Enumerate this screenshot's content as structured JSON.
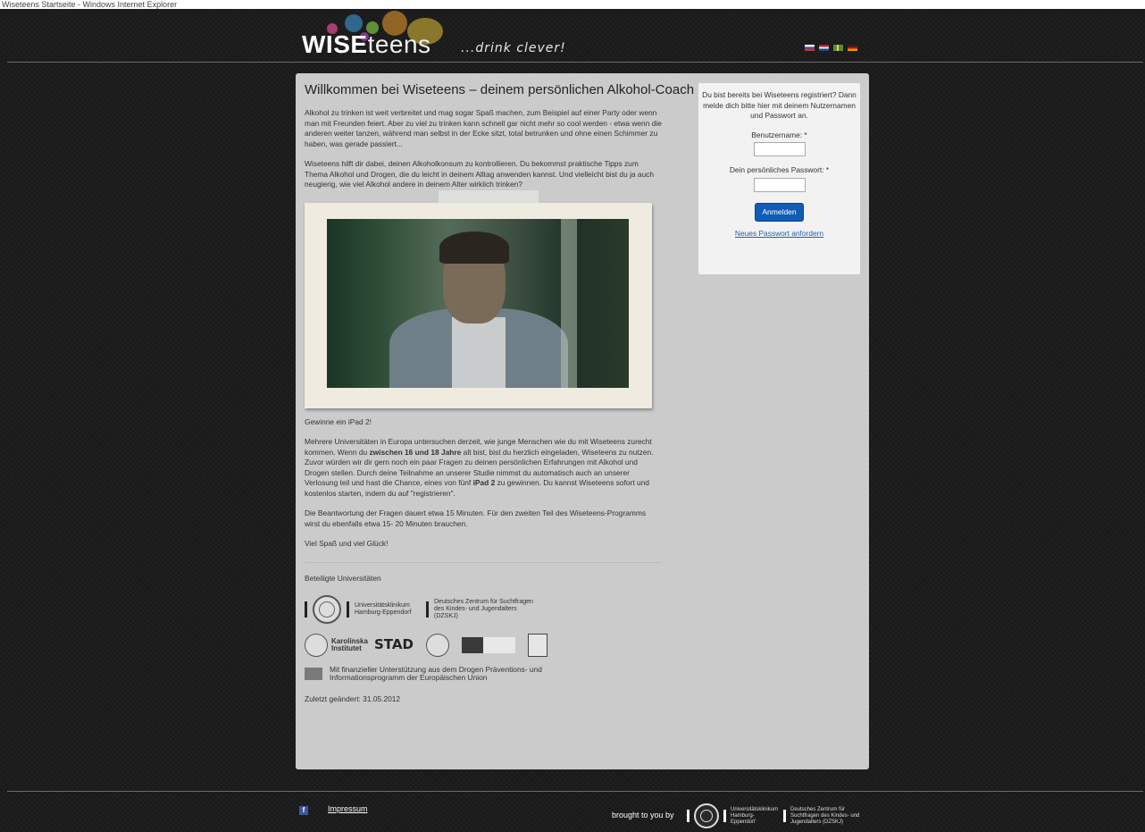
{
  "window": {
    "title": "Wiseteens Startseite - Windows Internet Explorer"
  },
  "header": {
    "logo_bold": "WISE",
    "logo_light": "teens",
    "tagline": "...drink clever!",
    "flags": [
      {
        "name": "flag-ru-icon",
        "color": "#c0392b"
      },
      {
        "name": "flag-nl-icon",
        "color": "#b22234"
      },
      {
        "name": "flag-se-icon",
        "color": "#5a8a3a"
      },
      {
        "name": "flag-de-icon",
        "color": "#e0a000"
      }
    ]
  },
  "content": {
    "title": "Willkommen bei Wiseteens – deinem persönlichen Alkohol-Coach",
    "intro_1": "Alkohol zu trinken ist weit verbreitet und mag sogar Spaß machen, zum Beispiel auf einer Party oder wenn man mit Freunden feiert. Aber zu viel zu trinken kann schnell gar nicht mehr so cool werden - etwa wenn die anderen weiter tanzen, während man selbst in der Ecke sitzt, total betrunken und ohne einen Schimmer zu haben, was gerade passiert...",
    "intro_2": "Wiseteens hilft dir dabei, deinen Alkoholkonsum zu kontrollieren. Du bekommst praktische Tipps zum Thema Alkohol und Drogen, die du leicht in deinem Alltag anwenden kannst. Und vielleicht bist du ja auch neugierig, wie viel Alkohol andere in deinem Alter wirklich trinken?",
    "win_title": "Gewinne ein iPad 2!",
    "study_a": "Mehrere Universitäten in Europa untersuchen derzeit, wie junge Menschen wie du mit Wiseteens zurecht kommen. Wenn du ",
    "study_bold_1": "zwischen 16 und 18 Jahre",
    "study_b": " alt bist, bist du herzlich eingeladen, Wiseteens zu nutzen. Zuvor würden wir dir gern noch ein paar Fragen zu deinen persönlichen Erfahrungen mit Alkohol und Drogen stellen. Durch deine Teilnahme an unserer Studie nimmst du automatisch auch an unserer Verlosung teil und hast die Chance, eines von fünf ",
    "study_bold_2": "iPad 2",
    "study_c": " zu gewinnen. Du kannst Wiseteens sofort und kostenlos starten, indem du auf \"registrieren\".",
    "duration": "Die Beantwortung der Fragen dauert etwa 15 Minuten. Für den zweiten Teil des Wiseteens-Programms wirst du ebenfalls etwa 15- 20 Minuten brauchen.",
    "goodluck": "Viel Spaß und viel Glück!",
    "universities_title": "Beteiligte Universitäten",
    "uke_name": "Universitätsklinikum Hamburg-Eppendorf",
    "dzskj_name": "Deutsches Zentrum für Suchtfragen des Kindes- und Jugendalters (DZSKJ)",
    "ki_name": "Karolinska Institutet",
    "stad_name": "STAD",
    "eu_text": "Mit finanzieller Unterstützung aus dem Drogen Präventions- und Informationsprogramm der Europäischen Union",
    "updated": "Zuletzt geändert: 31.05.2012"
  },
  "login": {
    "intro": "Du bist bereits bei Wiseteens registriert? Dann melde dich bitte hier mit deinem Nutzernamen und Passwort an.",
    "username_label": "Benutzername: *",
    "password_label": "Dein persönliches Passwort: *",
    "submit_label": "Anmelden",
    "reset_link": "Neues Passwort anfordern"
  },
  "footer": {
    "facebook_icon": "f",
    "impressum": "Impressum",
    "brought_by": "brought to you by",
    "uke_name": "Universitätsklinikum Hamburg-Eppendorf",
    "dzskj_name": "Deutsches Zentrum für Suchtfragen des Kindes- und Jugendalters (DZSKJ)"
  }
}
